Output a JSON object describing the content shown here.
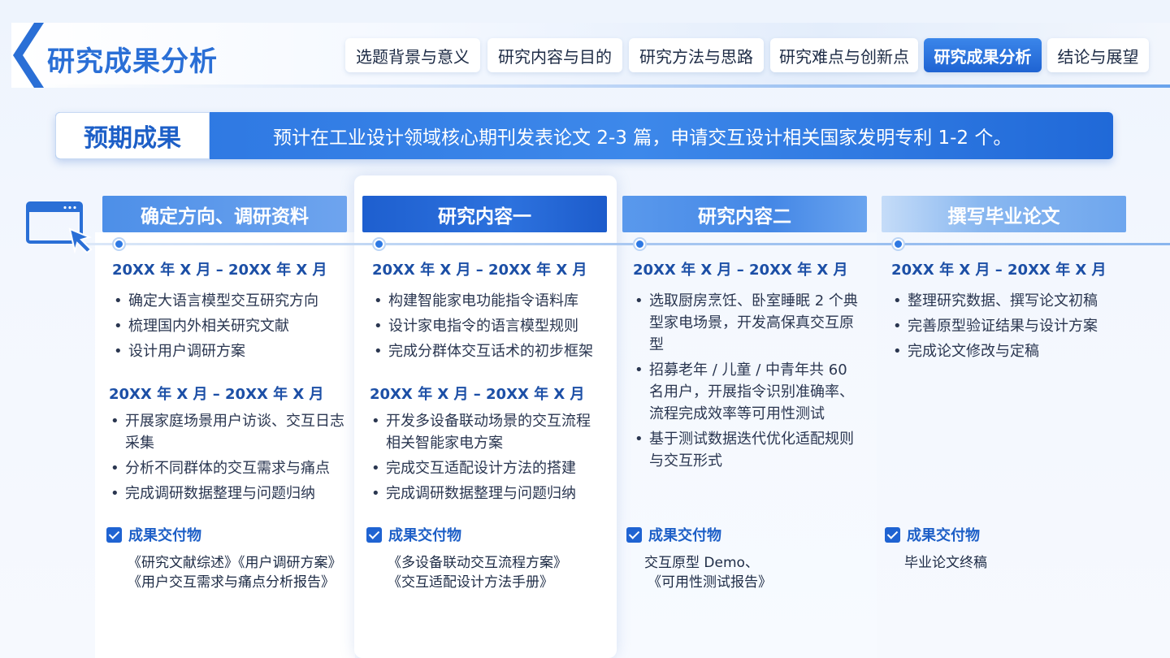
{
  "header": {
    "title": "研究成果分析",
    "tabs": [
      {
        "label": "选题背景与意义",
        "active": false
      },
      {
        "label": "研究内容与目的",
        "active": false
      },
      {
        "label": "研究方法与思路",
        "active": false
      },
      {
        "label": "研究难点与创新点",
        "active": false
      },
      {
        "label": "研究成果分析",
        "active": true
      },
      {
        "label": "结论与展望",
        "active": false
      }
    ]
  },
  "banner": {
    "label": "预期成果",
    "text": "预计在工业设计领域核心期刊发表论文 2-3 篇，申请交互设计相关国家发明专利 1-2 个。"
  },
  "columns": [
    {
      "title": "确定方向、调研资料",
      "groups": [
        {
          "date": "20XX 年 X 月 – 20XX 年 X 月",
          "items": [
            "确定大语言模型交互研究方向",
            "梳理国内外相关研究文献",
            "设计用户调研方案"
          ]
        },
        {
          "date": "20XX 年 X 月 – 20XX 年 X 月",
          "items": [
            "开展家庭场景用户访谈、交互日志采集",
            "分析不同群体的交互需求与痛点",
            "完成调研数据整理与问题归纳"
          ]
        }
      ],
      "deliverable_title": "成果交付物",
      "deliverables": [
        "《研究文献综述》《用户调研方案》",
        "《用户交互需求与痛点分析报告》"
      ]
    },
    {
      "title": "研究内容一",
      "groups": [
        {
          "date": "20XX 年 X 月 – 20XX 年 X 月",
          "items": [
            "构建智能家电功能指令语料库",
            "设计家电指令的语言模型规则",
            "完成分群体交互话术的初步框架"
          ]
        },
        {
          "date": "20XX 年 X 月 – 20XX 年 X 月",
          "items": [
            "开发多设备联动场景的交互流程相关智能家电方案",
            "完成交互适配设计方法的搭建",
            "完成调研数据整理与问题归纳"
          ]
        }
      ],
      "deliverable_title": "成果交付物",
      "deliverables": [
        "《多设备联动交互流程方案》",
        "《交互适配设计方法手册》"
      ]
    },
    {
      "title": "研究内容二",
      "groups": [
        {
          "date": "20XX 年 X 月 – 20XX 年 X 月",
          "items": [
            "选取厨房烹饪、卧室睡眠 2 个典型家电场景，开发高保真交互原型",
            "招募老年 / 儿童 / 中青年共 60 名用户，开展指令识别准确率、流程完成效率等可用性测试",
            "基于测试数据迭代优化适配规则与交互形式"
          ]
        }
      ],
      "deliverable_title": "成果交付物",
      "deliverables": [
        "交互原型 Demo、",
        "《可用性测试报告》"
      ]
    },
    {
      "title": "撰写毕业论文",
      "groups": [
        {
          "date": "20XX 年 X 月 – 20XX 年 X 月",
          "items": [
            "整理研究数据、撰写论文初稿",
            "完善原型验证结果与设计方案",
            "完成论文修改与定稿"
          ]
        }
      ],
      "deliverable_title": "成果交付物",
      "deliverables": [
        "毕业论文终稿"
      ]
    }
  ],
  "icons": {
    "back": "chevron-left-icon",
    "monitor": "monitor-cursor-icon",
    "check": "checkbox-checked-icon"
  },
  "colors": {
    "primary": "#1f63d2",
    "accent": "#2a6fd6",
    "text": "#1d2b45"
  }
}
